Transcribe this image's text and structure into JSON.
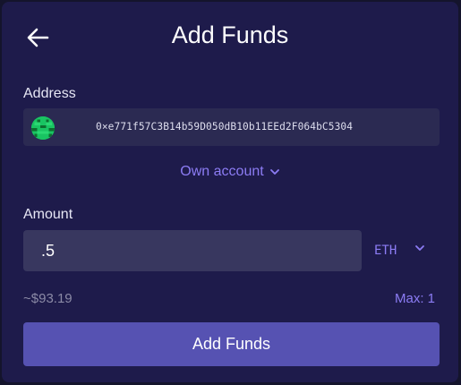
{
  "header": {
    "title": "Add Funds",
    "back_icon": "arrow-left-icon"
  },
  "address": {
    "label": "Address",
    "value": "0×e771f57C3B14b59D050dB10b11EEd2F064bC5304",
    "avatar_icon": "identicon-avatar"
  },
  "account_selector": {
    "label": "Own account",
    "icon": "chevron-down-icon"
  },
  "amount": {
    "label": "Amount",
    "value": ".5",
    "currency": "ETH",
    "currency_icon": "chevron-down-icon",
    "fiat_estimate": "~$93.19",
    "max_label": "Max: 1"
  },
  "submit": {
    "label": "Add Funds"
  },
  "colors": {
    "background": "#1e1b4b",
    "accent": "#8c7cf4",
    "button": "#5652b2",
    "input": "#38375f",
    "address_box": "#2b2a52",
    "avatar": "#16c060"
  }
}
